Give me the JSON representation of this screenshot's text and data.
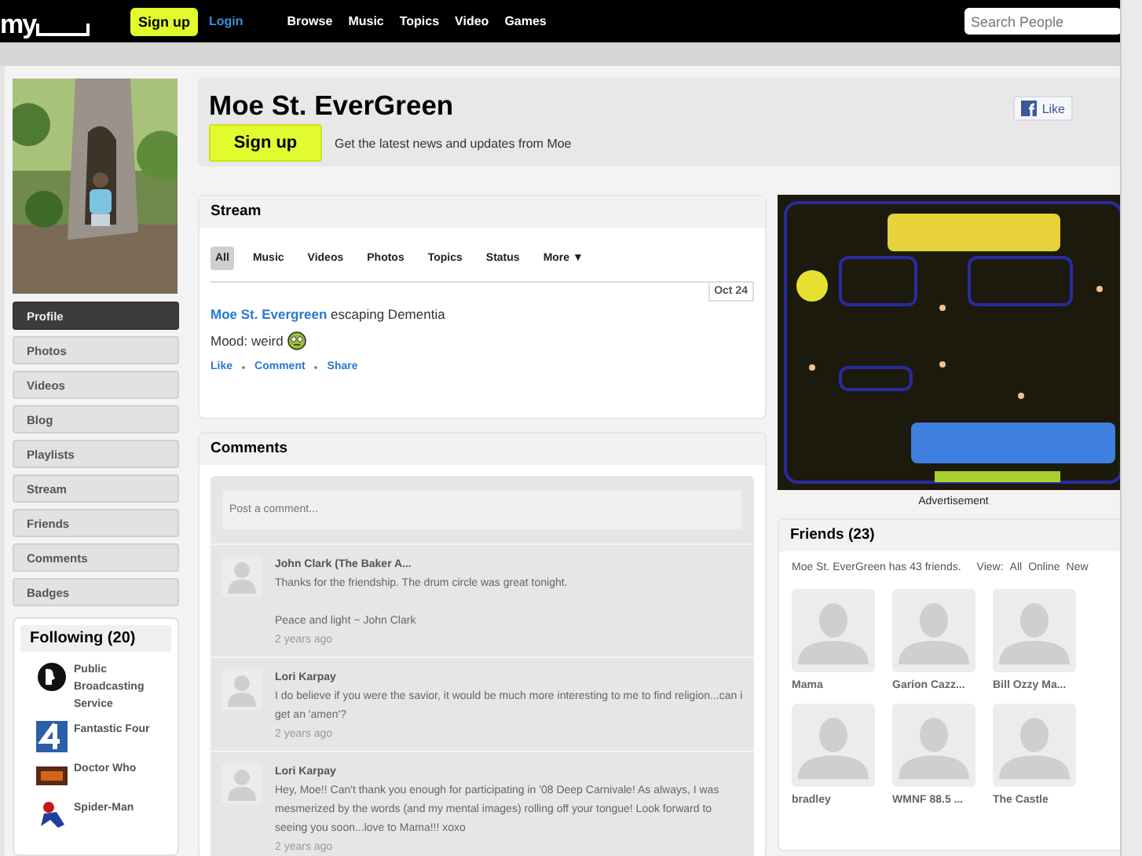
{
  "topbar": {
    "logo": "my",
    "signup": "Sign up",
    "login": "Login",
    "nav": [
      "Browse",
      "Music",
      "Topics",
      "Video",
      "Games"
    ],
    "search": {
      "placeholder": "Search People"
    }
  },
  "profile": {
    "menu": [
      {
        "label": "Profile",
        "selected": true
      },
      {
        "label": "Photos",
        "selected": false
      },
      {
        "label": "Videos",
        "selected": false
      },
      {
        "label": "Blog",
        "selected": false
      },
      {
        "label": "Playlists",
        "selected": false
      },
      {
        "label": "Stream",
        "selected": false
      },
      {
        "label": "Friends",
        "selected": false
      },
      {
        "label": "Comments",
        "selected": false
      },
      {
        "label": "Badges",
        "selected": false
      }
    ]
  },
  "following": {
    "title": "Following (20)",
    "items": [
      {
        "name": "Public Broadcasting Service",
        "kind": "pbs"
      },
      {
        "name": "Fantastic Four",
        "kind": "four"
      },
      {
        "name": "Doctor Who",
        "kind": "tv"
      },
      {
        "name": "Spider-Man",
        "kind": "hero"
      }
    ]
  },
  "header": {
    "name": "Moe St. EverGreen",
    "signup": "Sign up",
    "tagline": "Get the latest news and updates from Moe",
    "like": "Like"
  },
  "stream": {
    "title": "Stream",
    "tabs": [
      {
        "label": "All",
        "selected": true
      },
      {
        "label": "Music",
        "selected": false
      },
      {
        "label": "Videos",
        "selected": false
      },
      {
        "label": "Photos",
        "selected": false
      },
      {
        "label": "Topics",
        "selected": false
      },
      {
        "label": "Status",
        "selected": false
      },
      {
        "label": "More ▼",
        "selected": false
      }
    ],
    "post": {
      "date": "Oct 24",
      "author": "Moe St. Evergreen",
      "text": "escaping Dementia",
      "mood": "Mood: weird",
      "actions": [
        "Like",
        "Comment",
        "Share"
      ]
    }
  },
  "comments": {
    "title": "Comments",
    "placeholder": "Post a comment...",
    "items": [
      {
        "author": "John Clark (The Baker A...",
        "lines": [
          "Thanks for the friendship. The drum circle was great tonight.",
          "Peace and light ~ John Clark"
        ],
        "time": "2 years ago"
      },
      {
        "author": "Lori Karpay",
        "lines": [
          "I do believe if you were the savior, it would be much more interesting to me to find religion...can i get an 'amen'?"
        ],
        "time": "2 years ago"
      },
      {
        "author": "Lori Karpay",
        "lines": [
          "Hey, Moe!! Can't thank you enough for participating in '08 Deep Carnivale! As always, I was mesmerized by the words (and my mental images) rolling off your tongue! Look forward to seeing you soon...love to Mama!!! xoxo"
        ],
        "time": "2 years ago"
      }
    ]
  },
  "ad": {
    "caption": "Advertisement"
  },
  "friends": {
    "title": "Friends (23)",
    "summary": "Moe St. EverGreen has 43 friends.",
    "view_label": "View:",
    "views": [
      "All",
      "Online",
      "New"
    ],
    "items": [
      "Mama",
      "Garion Cazz...",
      "Bill Ozzy Ma...",
      "bradley",
      "WMNF 88.5 ...",
      "The Castle"
    ]
  }
}
